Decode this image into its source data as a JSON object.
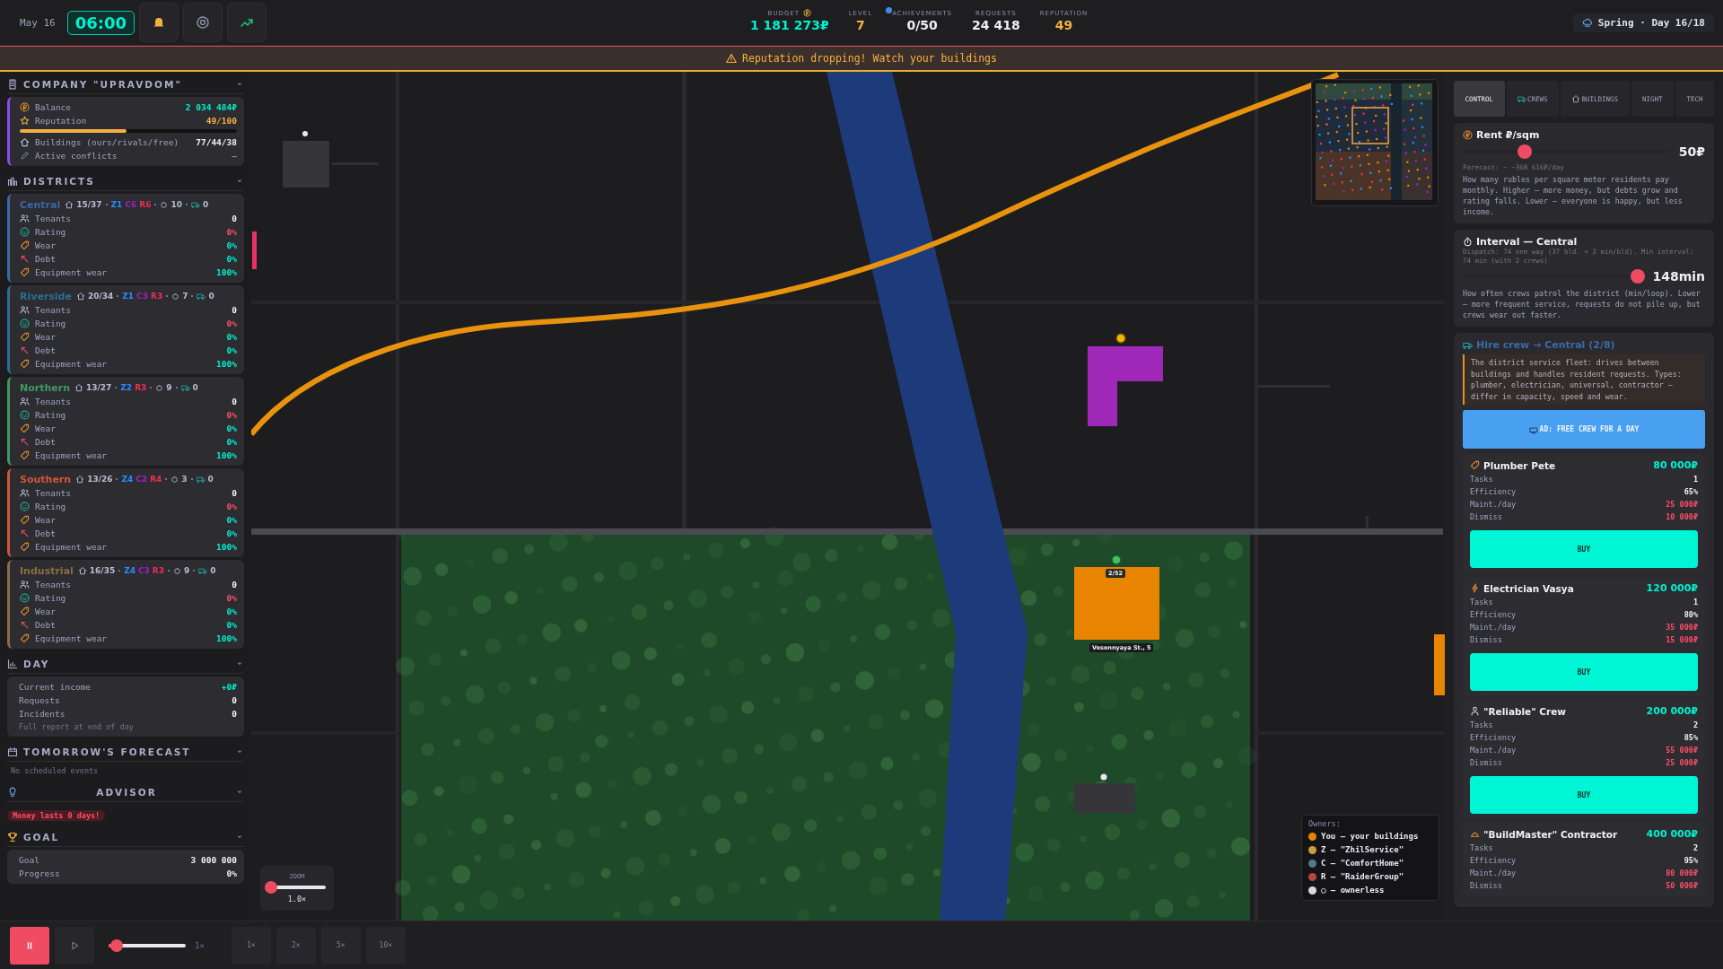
{
  "top_bar": {
    "date": "May 16",
    "time": "06:00",
    "stats": [
      {
        "label": "BUDGET",
        "value": "1 181 273₽",
        "kind": "coin",
        "color": "#00f0d0"
      },
      {
        "label": "LEVEL",
        "value": "7",
        "kind": "level",
        "color": "#f5b042"
      },
      {
        "label": "ACHIEVEMENTS",
        "value": "0/50",
        "kind": "plain",
        "color": "#f0f0f4"
      },
      {
        "label": "REQUESTS",
        "value": "24 418",
        "kind": "plain",
        "color": "#f0f0f4"
      },
      {
        "label": "REPUTATION",
        "value": "49",
        "kind": "plain",
        "color": "#f5b042"
      }
    ],
    "season": "Spring · Day 16/18"
  },
  "warning": "Reputation dropping! Watch your buildings",
  "sidebar": {
    "company": {
      "title": "COMPANY \"UPRAVDOM\"",
      "balance_label": "Balance",
      "balance": "2 034 484₽",
      "reputation_label": "Reputation",
      "reputation": "49/100",
      "level": 0.49,
      "buildings_label": "Buildings (ours/rivals/free)",
      "buildings": "77/44/38",
      "conflicts_label": "Active conflicts",
      "conflicts": "—"
    },
    "districts": {
      "title": "DISTRICTS",
      "items": [
        {
          "name": "Central",
          "color": "#3a68a8",
          "buildings": "15/37",
          "owners": [
            {
              "code": "Z1",
              "color": "#2a8cff"
            },
            {
              "code": "C6",
              "color": "#a020c0"
            },
            {
              "code": "R6",
              "color": "#ef2d56"
            }
          ],
          "patrols": "10",
          "crews": "0",
          "rows": [
            {
              "label": "Tenants",
              "value": "0",
              "kind": "tenants"
            },
            {
              "label": "Rating",
              "value": "0%",
              "kind": "rating"
            },
            {
              "label": "Wear",
              "value": "0%",
              "kind": "wear"
            },
            {
              "label": "Debt",
              "value": "0%",
              "kind": "debt"
            },
            {
              "label": "Equipment wear",
              "value": "100%",
              "kind": "equipment"
            }
          ]
        },
        {
          "name": "Riverside",
          "color": "#2a6f95",
          "buildings": "20/34",
          "owners": [
            {
              "code": "Z1",
              "color": "#2a8cff"
            },
            {
              "code": "C3",
              "color": "#a020c0"
            },
            {
              "code": "R3",
              "color": "#ef2d56"
            }
          ],
          "patrols": "7",
          "crews": "0",
          "rows": [
            {
              "label": "Tenants",
              "value": "0",
              "kind": "tenants"
            },
            {
              "label": "Rating",
              "value": "0%",
              "kind": "rating"
            },
            {
              "label": "Wear",
              "value": "0%",
              "kind": "wear"
            },
            {
              "label": "Debt",
              "value": "0%",
              "kind": "debt"
            },
            {
              "label": "Equipment wear",
              "value": "100%",
              "kind": "equipment"
            }
          ]
        },
        {
          "name": "Northern",
          "color": "#3f9a62",
          "buildings": "13/27",
          "owners": [
            {
              "code": "Z2",
              "color": "#2a8cff"
            },
            {
              "code": "R3",
              "color": "#ef2d56"
            }
          ],
          "patrols": "9",
          "crews": "0",
          "rows": [
            {
              "label": "Tenants",
              "value": "0",
              "kind": "tenants"
            },
            {
              "label": "Rating",
              "value": "0%",
              "kind": "rating"
            },
            {
              "label": "Wear",
              "value": "0%",
              "kind": "wear"
            },
            {
              "label": "Debt",
              "value": "0%",
              "kind": "debt"
            },
            {
              "label": "Equipment wear",
              "value": "100%",
              "kind": "equipment"
            }
          ]
        },
        {
          "name": "Southern",
          "color": "#d0563a",
          "buildings": "13/26",
          "owners": [
            {
              "code": "Z4",
              "color": "#2a8cff"
            },
            {
              "code": "C2",
              "color": "#a020c0"
            },
            {
              "code": "R4",
              "color": "#ef2d56"
            }
          ],
          "patrols": "3",
          "crews": "0",
          "rows": [
            {
              "label": "Tenants",
              "value": "0",
              "kind": "tenants"
            },
            {
              "label": "Rating",
              "value": "0%",
              "kind": "rating"
            },
            {
              "label": "Wear",
              "value": "0%",
              "kind": "wear"
            },
            {
              "label": "Debt",
              "value": "0%",
              "kind": "debt"
            },
            {
              "label": "Equipment wear",
              "value": "100%",
              "kind": "equipment"
            }
          ]
        },
        {
          "name": "Industrial",
          "color": "#8c6c44",
          "buildings": "16/35",
          "owners": [
            {
              "code": "Z4",
              "color": "#2a8cff"
            },
            {
              "code": "C3",
              "color": "#a020c0"
            },
            {
              "code": "R3",
              "color": "#ef2d56"
            }
          ],
          "patrols": "9",
          "crews": "0",
          "rows": [
            {
              "label": "Tenants",
              "value": "0",
              "kind": "tenants"
            },
            {
              "label": "Rating",
              "value": "0%",
              "kind": "rating"
            },
            {
              "label": "Wear",
              "value": "0%",
              "kind": "wear"
            },
            {
              "label": "Debt",
              "value": "0%",
              "kind": "debt"
            },
            {
              "label": "Equipment wear",
              "value": "100%",
              "kind": "equipment"
            }
          ]
        }
      ]
    },
    "day": {
      "title": "DAY",
      "rows": [
        {
          "label": "Current income",
          "value": "+0₽",
          "kind": "income"
        },
        {
          "label": "Requests",
          "value": "0",
          "kind": "count"
        },
        {
          "label": "Incidents",
          "value": "0",
          "kind": "count"
        }
      ],
      "note": "Full report at end of day"
    },
    "forecast": {
      "title": "TOMORROW'S FORECAST",
      "note": "No scheduled events"
    },
    "advisor": {
      "title": "ADVISOR",
      "alert": "Money lasts 0 days!"
    },
    "goal": {
      "title": "GOAL",
      "rows": [
        {
          "label": "Goal",
          "value": "3 000 000"
        },
        {
          "label": "Progress",
          "value": "0%"
        }
      ]
    }
  },
  "map": {
    "building": {
      "occupancy": "2/52",
      "address": "Vesennyaya St., 5"
    },
    "zoom": {
      "label": "ZOOM",
      "level": 0.05,
      "value": "1.0×"
    },
    "legend": {
      "title": "Owners:",
      "items": [
        {
          "text": "You — your buildings",
          "color": "#e88400"
        },
        {
          "text": "Z — \"ZhilService\"",
          "color": "#c9a040"
        },
        {
          "text": "C — \"ComfortHome\"",
          "color": "#4f7a8a"
        },
        {
          "text": "R — \"RaiderGroup\"",
          "color": "#b84444"
        },
        {
          "text": "○ — ownerless",
          "color": "#d8d8e0"
        }
      ]
    }
  },
  "control_panel": {
    "tabs": [
      {
        "label": "CONTROL",
        "kind": "plain",
        "selected": true
      },
      {
        "label": "CREWS",
        "kind": "crews",
        "selected": false
      },
      {
        "label": "BUILDINGS",
        "kind": "buildings",
        "selected": false
      },
      {
        "label": "NIGHT",
        "kind": "plain",
        "selected": false
      },
      {
        "label": "TECH",
        "kind": "plain",
        "selected": false
      }
    ],
    "rent": {
      "title": "Rent ₽/sqm",
      "level": 0.3,
      "value": "50₽",
      "forecast": "Forecast: ~ ~368 616₽/day",
      "description": "How many rubles per square meter residents pay monthly. Higher — more money, but debts grow and rating falls. Lower — everyone is happy, but less income."
    },
    "interval": {
      "title": "Interval — Central",
      "dispatch": "Dispatch: 74 one way (37 bld. × 2 min/bld). Min interval: 74 min (with 2 crews)",
      "level": 0.97,
      "value": "148min",
      "description": "How often crews patrol the district (min/loop). Lower — more frequent service, requests do not pile up, but crews wear out faster."
    },
    "hire": {
      "title": "Hire crew → Central (2/8)",
      "info": "The district service fleet: drives between buildings and handles resident requests. Types: plumber, electrician, universal, contractor — differ in capacity, speed and wear.",
      "ad_button": "AD: FREE CREW FOR A DAY",
      "crews": [
        {
          "name": "Plumber Pete",
          "kind": "plumber",
          "price": "80 000₽",
          "stats": [
            {
              "label": "Tasks",
              "value": "1",
              "kind": "plain"
            },
            {
              "label": "Efficiency",
              "value": "65%",
              "kind": "plain"
            },
            {
              "label": "Maint./day",
              "value": "25 000₽",
              "kind": "cost"
            },
            {
              "label": "Dismiss",
              "value": "10 000₽",
              "kind": "cost"
            }
          ],
          "button": "BUY"
        },
        {
          "name": "Electrician Vasya",
          "kind": "electrician",
          "price": "120 000₽",
          "stats": [
            {
              "label": "Tasks",
              "value": "1",
              "kind": "plain"
            },
            {
              "label": "Efficiency",
              "value": "80%",
              "kind": "plain"
            },
            {
              "label": "Maint./day",
              "value": "35 000₽",
              "kind": "cost"
            },
            {
              "label": "Dismiss",
              "value": "15 000₽",
              "kind": "cost"
            }
          ],
          "button": "BUY"
        },
        {
          "name": "\"Reliable\" Crew",
          "kind": "universal",
          "price": "200 000₽",
          "stats": [
            {
              "label": "Tasks",
              "value": "2",
              "kind": "plain"
            },
            {
              "label": "Efficiency",
              "value": "85%",
              "kind": "plain"
            },
            {
              "label": "Maint./day",
              "value": "55 000₽",
              "kind": "cost"
            },
            {
              "label": "Dismiss",
              "value": "25 000₽",
              "kind": "cost"
            }
          ],
          "button": "BUY"
        },
        {
          "name": "\"BuildMaster\" Contractor",
          "kind": "contractor",
          "price": "400 000₽",
          "stats": [
            {
              "label": "Tasks",
              "value": "2",
              "kind": "plain"
            },
            {
              "label": "Efficiency",
              "value": "95%",
              "kind": "plain"
            },
            {
              "label": "Maint./day",
              "value": "80 000₽",
              "kind": "cost"
            },
            {
              "label": "Dismiss",
              "value": "50 000₽",
              "kind": "cost"
            }
          ]
        }
      ]
    }
  },
  "bottom_bar": {
    "pause_selected": true,
    "speed": {
      "level": 0.1,
      "value": "1×"
    },
    "speeds": [
      {
        "label": "1×",
        "selected": false
      },
      {
        "label": "2×",
        "selected": false
      },
      {
        "label": "5×",
        "selected": false
      },
      {
        "label": "10×",
        "selected": false
      }
    ]
  }
}
